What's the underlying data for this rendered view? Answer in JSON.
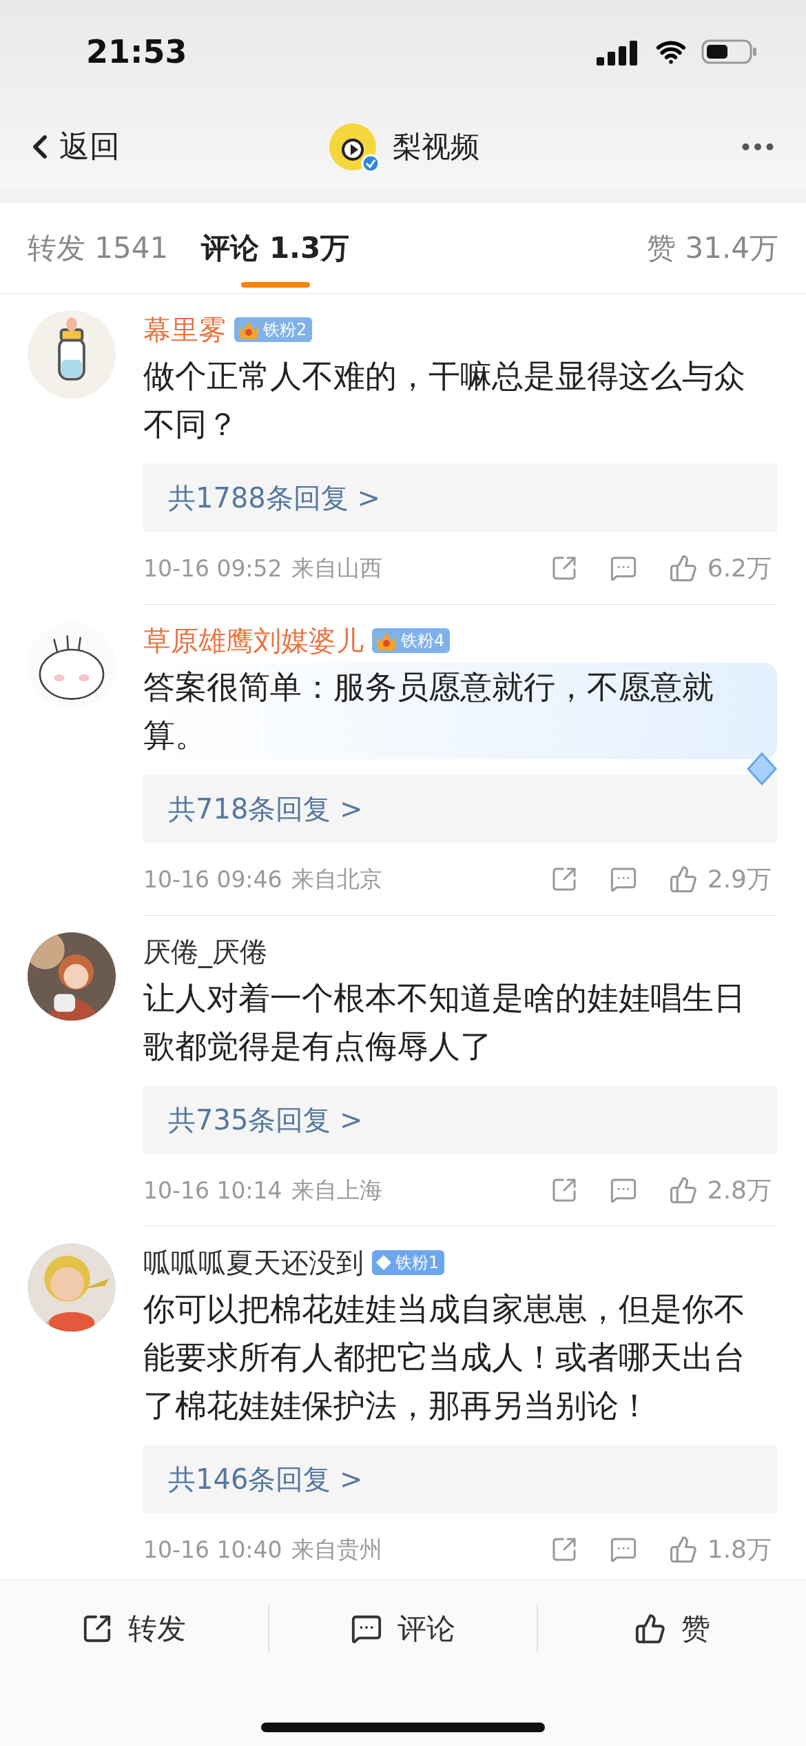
{
  "status_bar": {
    "time": "21:53"
  },
  "nav": {
    "back": "返回",
    "title": "梨视频"
  },
  "tabs": [
    {
      "label": "转发",
      "count": "1541",
      "selected": false
    },
    {
      "label": "评论",
      "count": "1.3万",
      "selected": true
    },
    {
      "label": "赞",
      "count": "31.4万",
      "selected": false
    }
  ],
  "comments": [
    {
      "name": "幕里雾",
      "vip": true,
      "badge": {
        "kind": "crown",
        "label": "铁粉2"
      },
      "text": "做个正常人不难的，干嘛总是显得这么与众不同？",
      "bubble": false,
      "replies": "共1788条回复 >",
      "time": "10-16 09:52",
      "location": "来自山西",
      "likes": "6.2万"
    },
    {
      "name": "草原雄鹰刘媒婆儿",
      "vip": true,
      "badge": {
        "kind": "crown",
        "label": "铁粉4"
      },
      "text": "答案很简单：服务员愿意就行，不愿意就算。",
      "bubble": true,
      "replies": "共718条回复 >",
      "time": "10-16 09:46",
      "location": "来自北京",
      "likes": "2.9万"
    },
    {
      "name": "厌倦_厌倦",
      "vip": false,
      "text": "让人对着一个根本不知道是啥的娃娃唱生日歌都觉得是有点侮辱人了",
      "bubble": false,
      "replies": "共735条回复 >",
      "time": "10-16 10:14",
      "location": "来自上海",
      "likes": "2.8万"
    },
    {
      "name": "呱呱呱夏天还没到",
      "vip": false,
      "badge": {
        "kind": "diamond",
        "label": "铁粉1"
      },
      "text": "你可以把棉花娃娃当成自家崽崽，但是你不能要求所有人都把它当成人！或者哪天出台了棉花娃娃保护法，那再另当别论！",
      "bubble": false,
      "replies": "共146条回复 >",
      "time": "10-16 10:40",
      "location": "来自贵州",
      "likes": "1.8万"
    }
  ],
  "bottom_bar": [
    {
      "kind": "share",
      "label": "转发"
    },
    {
      "kind": "comment",
      "label": "评论"
    },
    {
      "kind": "like",
      "label": "赞"
    }
  ]
}
